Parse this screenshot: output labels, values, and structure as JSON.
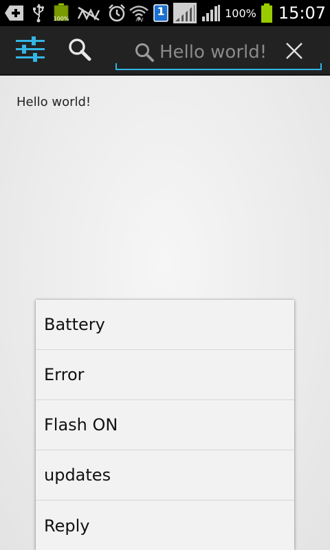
{
  "status_bar": {
    "battery_small_label": "100%",
    "notification_badge": "1",
    "battery_percent": "100%",
    "time": "15:07"
  },
  "action_bar": {
    "search_field": {
      "placeholder": "Hello world!"
    }
  },
  "content": {
    "text": "Hello world!"
  },
  "popup_menu": {
    "items": [
      {
        "label": "Battery"
      },
      {
        "label": "Error"
      },
      {
        "label": "Flash ON"
      },
      {
        "label": "updates"
      },
      {
        "label": "Reply"
      }
    ]
  },
  "colors": {
    "accent": "#33b5e5",
    "action_bar_bg": "#222222",
    "status_bar_bg": "#000000",
    "battery_green": "#99cc00"
  },
  "icons": {
    "settings": "sliders-icon",
    "search": "search-icon",
    "clear": "close-icon"
  }
}
